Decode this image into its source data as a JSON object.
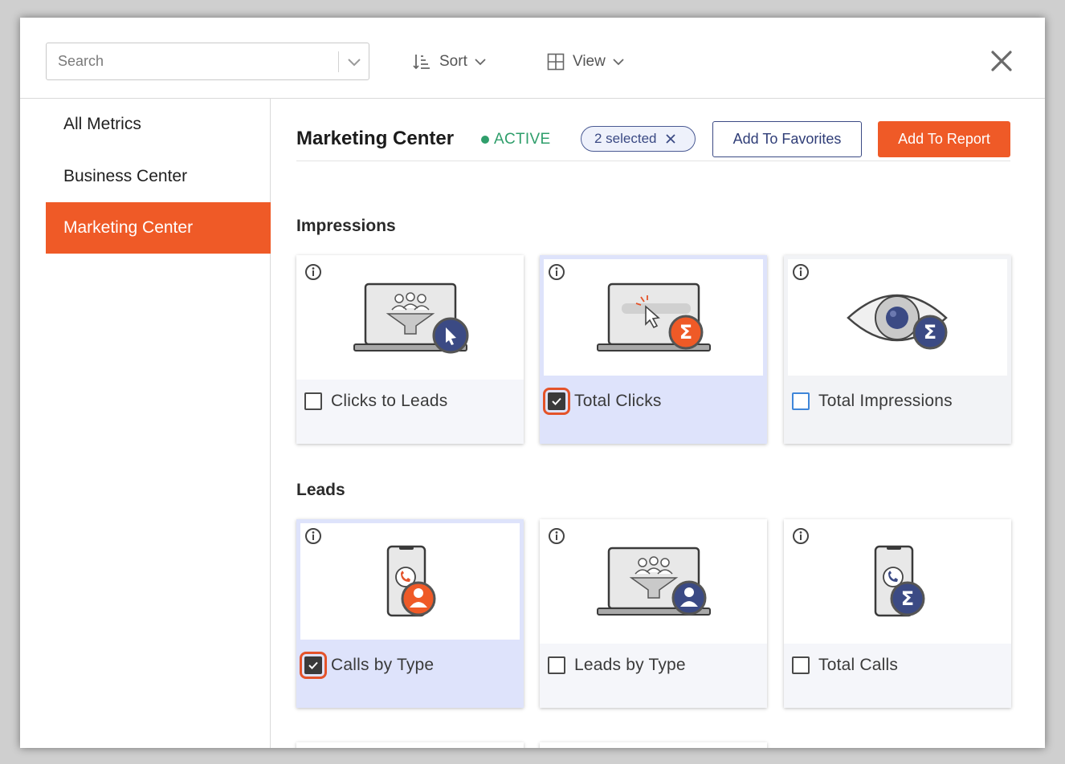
{
  "search": {
    "placeholder": "Search"
  },
  "toolbar": {
    "sort_label": "Sort",
    "view_label": "View"
  },
  "sidebar": {
    "items": [
      {
        "label": "All Metrics",
        "active": false
      },
      {
        "label": "Business Center",
        "active": false
      },
      {
        "label": "Marketing Center",
        "active": true
      }
    ]
  },
  "header": {
    "title": "Marketing Center",
    "status": "ACTIVE",
    "selected_chip": "2 selected",
    "favorites_label": "Add To Favorites",
    "report_label": "Add To Report"
  },
  "sections": [
    {
      "title": "Impressions",
      "cards": [
        {
          "label": "Clicks to Leads",
          "checked": false,
          "icon": "laptop-funnel-cursor-icon"
        },
        {
          "label": "Total Clicks",
          "checked": true,
          "icon": "laptop-click-sigma-icon"
        },
        {
          "label": "Total Impressions",
          "checked": false,
          "icon": "eye-sigma-icon"
        }
      ]
    },
    {
      "title": "Leads",
      "cards": [
        {
          "label": "Calls by Type",
          "checked": true,
          "icon": "phone-call-user-icon"
        },
        {
          "label": "Leads by Type",
          "checked": false,
          "icon": "laptop-funnel-user-icon"
        },
        {
          "label": "Total Calls",
          "checked": false,
          "icon": "phone-call-sigma-icon"
        }
      ]
    }
  ],
  "colors": {
    "accent": "#ef5a27",
    "navy": "#3b4a84",
    "active_green": "#2f9e6b",
    "selected_card": "#dee3fb"
  }
}
